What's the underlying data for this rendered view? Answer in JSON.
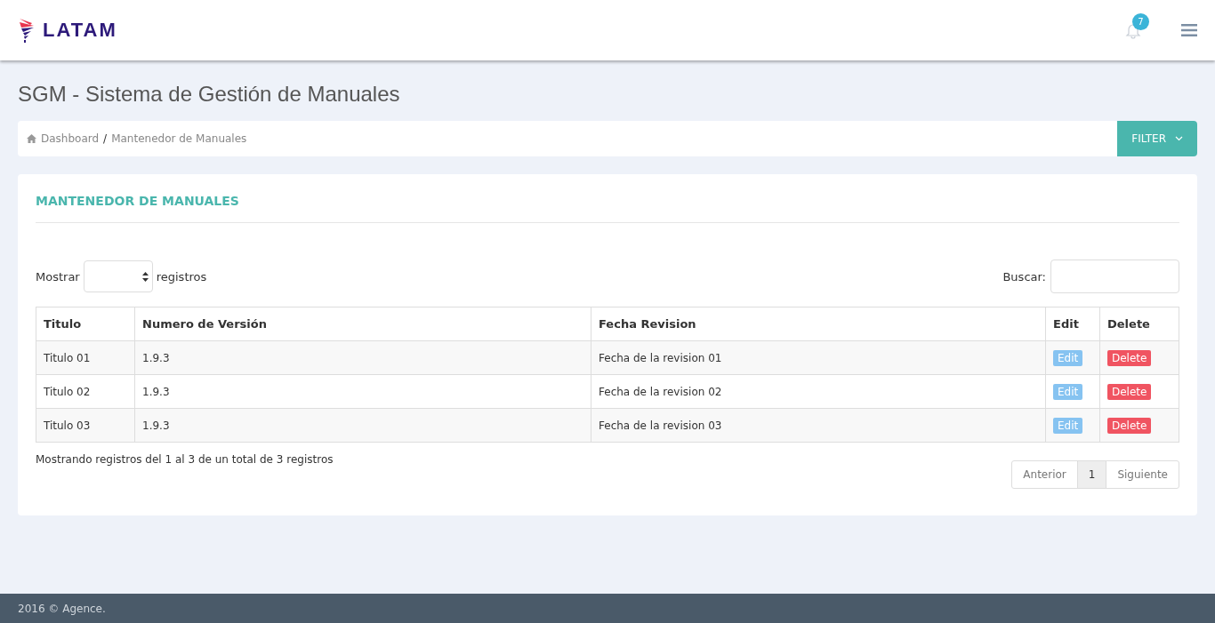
{
  "header": {
    "brand": "LATAM",
    "notifications": "7"
  },
  "page_title": "SGM - Sistema de Gestión de Manuales",
  "breadcrumb": {
    "items": [
      "Dashboard",
      "Mantenedor de Manuales"
    ],
    "separator": "/"
  },
  "filter_button": "FILTER",
  "card": {
    "title": "MANTENEDOR DE MANUALES",
    "length": {
      "before": "Mostrar",
      "after": "registros"
    },
    "search": {
      "label": "Buscar:"
    },
    "table": {
      "columns": [
        "Titulo",
        "Numero de Versión",
        "Fecha Revision",
        "Edit",
        "Delete"
      ],
      "rows": [
        {
          "title": "Titulo 01",
          "version": "1.9.3",
          "date": "Fecha de la revision 01",
          "edit": "Edit",
          "delete": "Delete"
        },
        {
          "title": "Titulo 02",
          "version": "1.9.3",
          "date": "Fecha de la revision 02",
          "edit": "Edit",
          "delete": "Delete"
        },
        {
          "title": "Titulo 03",
          "version": "1.9.3",
          "date": "Fecha de la revision 03",
          "edit": "Edit",
          "delete": "Delete"
        }
      ]
    },
    "info": "Mostrando registros del 1 al 3 de un total de 3 registros",
    "pagination": [
      {
        "label": "Anterior",
        "selected": false
      },
      {
        "label": "1",
        "selected": true
      },
      {
        "label": "Siguiente",
        "selected": false
      }
    ]
  },
  "footer": "2016 © Agence."
}
